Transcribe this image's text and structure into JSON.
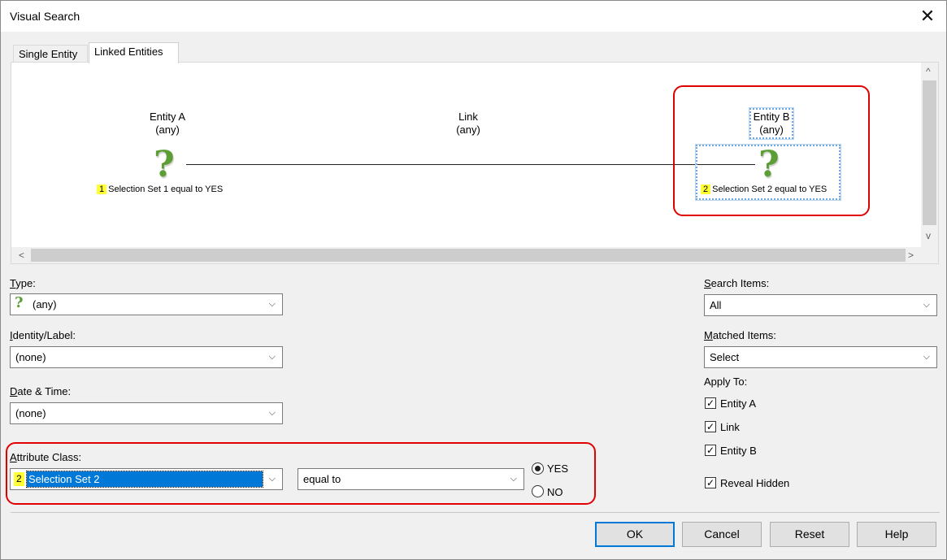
{
  "window": {
    "title": "Visual Search",
    "close_glyph": "✕"
  },
  "tabs": [
    {
      "label": "Single Entity",
      "active": false
    },
    {
      "label": "Linked Entities",
      "active": true
    }
  ],
  "diagram": {
    "entity_a": {
      "name": "Entity A",
      "type": "(any)",
      "badge": "1",
      "condition": "Selection Set 1 equal to YES"
    },
    "link": {
      "name": "Link",
      "type": "(any)"
    },
    "entity_b": {
      "name": "Entity B",
      "type": "(any)",
      "badge": "2",
      "condition": "Selection Set 2 equal to YES"
    },
    "icon_glyph": "?"
  },
  "fields": {
    "type": {
      "label_u": "T",
      "label_rest": "ype:",
      "value": "(any)"
    },
    "identity": {
      "label_u": "I",
      "label_rest": "dentity/Label:",
      "value": "(none)"
    },
    "datetime": {
      "label_u": "D",
      "label_rest": "ate & Time:",
      "value": "(none)"
    },
    "attribute_class": {
      "label_u": "A",
      "label_rest": "ttribute Class:",
      "badge": "2",
      "value": "Selection Set 2"
    },
    "operator": {
      "value": "equal to"
    },
    "yes": {
      "label": "YES",
      "checked": true
    },
    "no": {
      "label": "NO",
      "checked": false
    }
  },
  "right_panel": {
    "search_items": {
      "label_u": "S",
      "label_rest": "earch Items:",
      "value": "All"
    },
    "matched_items": {
      "label_u": "M",
      "label_rest": "atched Items:",
      "value": "Select"
    },
    "apply_to": {
      "label": "Apply To:"
    },
    "checks": [
      {
        "label": "Entity A",
        "checked": true
      },
      {
        "label": "Link",
        "checked": true
      },
      {
        "label": "Entity B",
        "checked": true
      },
      {
        "label": "Reveal Hidden",
        "checked": true
      }
    ]
  },
  "buttons": {
    "ok": "OK",
    "cancel": "Cancel",
    "reset": "Reset",
    "help": "Help"
  },
  "glyphs": {
    "chevron": "⌵",
    "check": "✓",
    "arrow_left": "<",
    "arrow_right": ">",
    "arrow_up": "^",
    "arrow_down": "v"
  },
  "colors": {
    "accent": "#0078d7",
    "highlight_red": "#e00000",
    "badge_yellow": "#ffff33",
    "icon_green": "#5c9e35"
  }
}
